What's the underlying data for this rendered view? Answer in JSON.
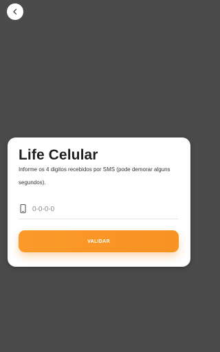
{
  "header": {
    "back_icon": "chevron-left-icon"
  },
  "card": {
    "title": "Life Celular",
    "subtitle": "Informe os 4 digitos recebidos por SMS (pode demorar alguns segundos).",
    "code_field": {
      "icon": "smartphone-icon",
      "placeholder": "0-0-0-0",
      "value": ""
    },
    "validate_label": "VALIDAR"
  },
  "colors": {
    "background": "#4b4b4b",
    "card": "#ffffff",
    "accent": "#f7931e",
    "button_text": "#ffffff"
  }
}
